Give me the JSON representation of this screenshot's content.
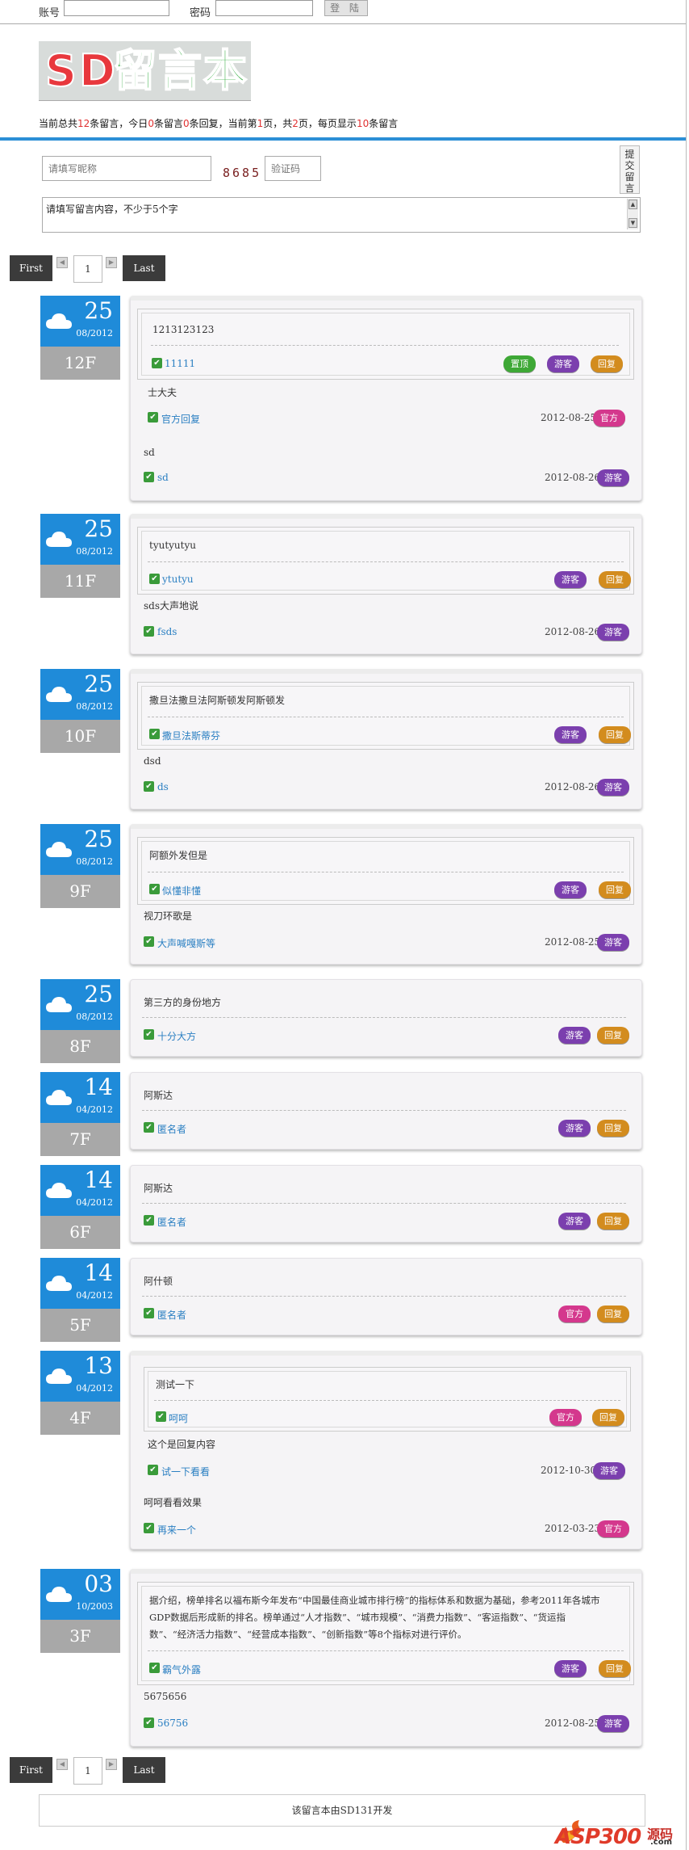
{
  "login": {
    "account_label": "账号",
    "password_label": "密码",
    "login_button": "登 陆"
  },
  "logo": {
    "letters": [
      "S",
      "D",
      "留",
      "言",
      "本"
    ]
  },
  "stats": {
    "p1": "当前总共",
    "total": "12",
    "p2": "条留言，今日",
    "today": "0",
    "p3": "条留言",
    "reply_today": "0",
    "p4": "条回复，当前第",
    "page": "1",
    "p5": "页，共",
    "pages": "2",
    "p6": "页，每页显示",
    "per_page": "10",
    "p7": "条留言"
  },
  "form": {
    "nickname_placeholder": "请填写昵称",
    "captcha_value": "8685",
    "captcha_placeholder": "验证码",
    "submit_label": "提交留言",
    "content_placeholder": "请填写留言内容，不少于5个字",
    "scroll_up": "▲",
    "scroll_down": "▼"
  },
  "pager": {
    "first": "First",
    "last": "Last",
    "page": "1",
    "prev_arrow": "◀",
    "next_arrow": "▶"
  },
  "tags": {
    "guest": "游客",
    "reply": "回复",
    "official": "官方",
    "pin": "置顶",
    "check": "✔"
  },
  "posts": [
    {
      "day": "25",
      "month_year": "08/2012",
      "floor": "12F",
      "q_text": "1213123123",
      "q_name": "11111",
      "body": "士大夫",
      "official_name": "官方回复",
      "official_date": "2012-08-25",
      "reply_text": "sd",
      "reply_name": "sd",
      "reply_date": "2012-08-26"
    },
    {
      "day": "25",
      "month_year": "08/2012",
      "floor": "11F",
      "q_text": "tyutyutyu",
      "q_name": "ytutyu",
      "reply_text": "sds大声地说",
      "reply_name": "fsds",
      "reply_date": "2012-08-26"
    },
    {
      "day": "25",
      "month_year": "08/2012",
      "floor": "10F",
      "q_text": "撒旦法撒旦法阿斯顿发阿斯顿发",
      "q_name": "撒旦法斯蒂芬",
      "reply_text": "dsd",
      "reply_name": "ds",
      "reply_date": "2012-08-26"
    },
    {
      "day": "25",
      "month_year": "08/2012",
      "floor": "9F",
      "q_text": "阿额外发但是",
      "q_name": "似懂非懂",
      "reply_text": "视刀环歌是",
      "reply_name": "大声喊嘎斯等",
      "reply_date": "2012-08-25"
    },
    {
      "day": "25",
      "month_year": "08/2012",
      "floor": "8F",
      "text": "第三方的身份地方",
      "name": "十分大方"
    },
    {
      "day": "14",
      "month_year": "04/2012",
      "floor": "7F",
      "text": "阿斯达",
      "name": "匿名者"
    },
    {
      "day": "14",
      "month_year": "04/2012",
      "floor": "6F",
      "text": "阿斯达",
      "name": "匿名者"
    },
    {
      "day": "14",
      "month_year": "04/2012",
      "floor": "5F",
      "text": "阿什顿",
      "name": "匿名者"
    },
    {
      "day": "13",
      "month_year": "04/2012",
      "floor": "4F",
      "q_text": "测试一下",
      "q_name": "呵呵",
      "reply_text": "这个是回复内容",
      "reply_name": "试一下看看",
      "reply_date": "2012-10-30",
      "reply2_text": "呵呵看看效果",
      "reply2_name": "再来一个",
      "reply2_date": "2012-03-23"
    },
    {
      "day": "03",
      "month_year": "10/2003",
      "floor": "3F",
      "q_line1": "据介绍，榜单排名以福布斯今年发布“中国最佳商业城市排行榜”的指标体系和数据为基础，参考2011年各城市",
      "q_line2": "GDP数据后形成新的排名。榜单通过“人才指数”、“城市规模”、“消费力指数”、“客运指数”、“货运指",
      "q_line3": "数”、“经济活力指数”、“经营成本指数”、“创新指数”等8个指标对进行评价。",
      "q_name": "霸气外露",
      "reply_text": "5675656",
      "reply_name": "56756",
      "reply_date": "2012-08-25"
    }
  ],
  "footer": {
    "text": "该留言本由SD131开发"
  },
  "watermark": {
    "brand": "ASP300",
    "cn": "源码",
    "dotcom": ".com"
  },
  "colors": {
    "accent_blue": "#1f8bd9",
    "floor_gray": "#a8a8a8",
    "guest_tag": "#7b3fae",
    "reply_tag": "#d38c1e",
    "official_tag": "#d4388d",
    "pin_tag": "#3ea836",
    "check_green": "#3a9b3a"
  }
}
